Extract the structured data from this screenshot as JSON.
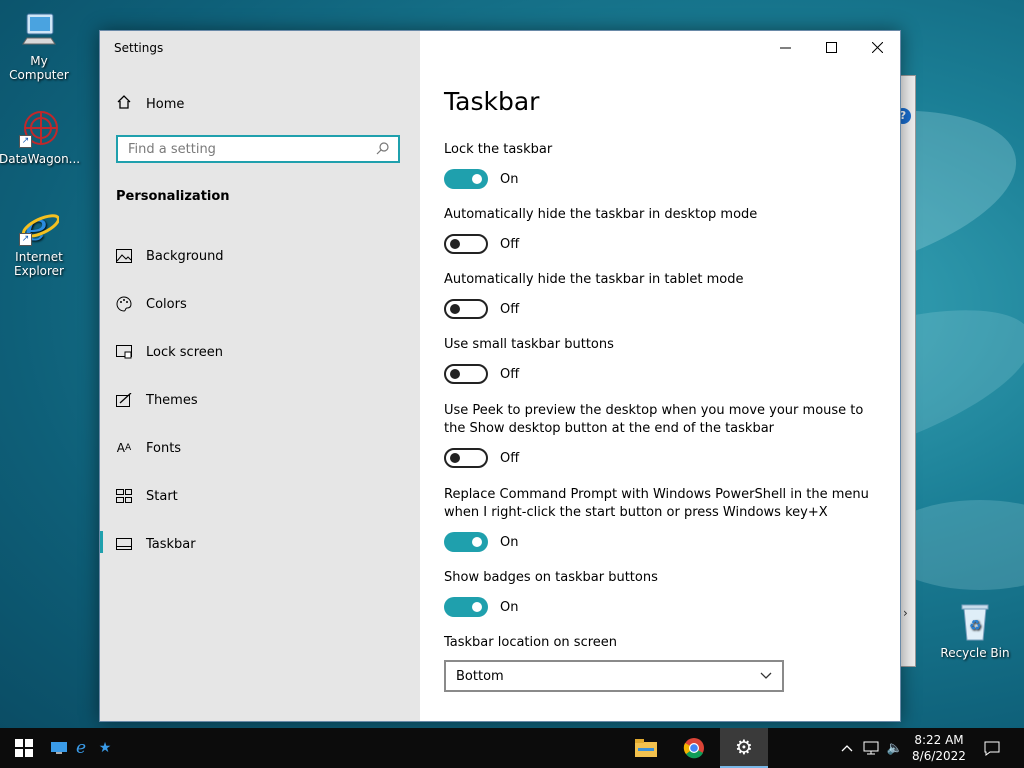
{
  "desktop": {
    "icons": [
      {
        "label": "My Computer",
        "icon": "computer-icon"
      },
      {
        "label": "DataWagon...",
        "icon": "datawagon-icon"
      },
      {
        "label": "Internet Explorer",
        "icon": "internet-explorer-icon"
      },
      {
        "label": "Recycle Bin",
        "icon": "recycle-bin-icon"
      }
    ]
  },
  "window": {
    "title": "Settings",
    "home_label": "Home",
    "search_placeholder": "Find a setting",
    "section": "Personalization",
    "nav": [
      {
        "label": "Background",
        "icon": "picture-icon"
      },
      {
        "label": "Colors",
        "icon": "palette-icon"
      },
      {
        "label": "Lock screen",
        "icon": "lock-screen-icon"
      },
      {
        "label": "Themes",
        "icon": "themes-icon"
      },
      {
        "label": "Fonts",
        "icon": "fonts-icon"
      },
      {
        "label": "Start",
        "icon": "start-icon"
      },
      {
        "label": "Taskbar",
        "icon": "taskbar-icon",
        "selected": true
      }
    ]
  },
  "content": {
    "title": "Taskbar",
    "settings": [
      {
        "label": "Lock the taskbar",
        "state": "On"
      },
      {
        "label": "Automatically hide the taskbar in desktop mode",
        "state": "Off"
      },
      {
        "label": "Automatically hide the taskbar in tablet mode",
        "state": "Off"
      },
      {
        "label": "Use small taskbar buttons",
        "state": "Off"
      },
      {
        "label": "Use Peek to preview the desktop when you move your mouse to the Show desktop button at the end of the taskbar",
        "state": "Off"
      },
      {
        "label": "Replace Command Prompt with Windows PowerShell in the menu when I right-click the start button or press Windows key+X",
        "state": "On"
      },
      {
        "label": "Show badges on taskbar buttons",
        "state": "On"
      }
    ],
    "location_label": "Taskbar location on screen",
    "location_value": "Bottom"
  },
  "taskbar": {
    "time": "8:22 AM",
    "date": "8/6/2022"
  },
  "colors": {
    "accent": "#1fa0ad",
    "sidebar": "#e6e6e6",
    "taskbar": "#0c0c0c"
  }
}
